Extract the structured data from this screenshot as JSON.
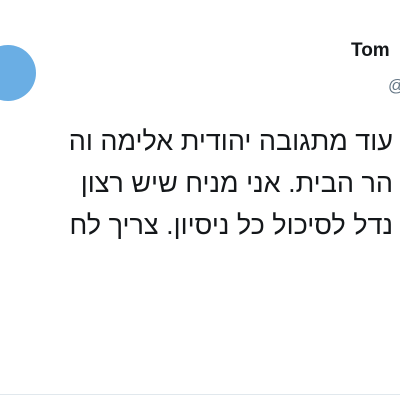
{
  "user": {
    "display_name": "Tom",
    "handle": "@"
  },
  "tweet": {
    "lines": [
      "עוד מתגובה יהודית אלימה וה",
      "הר הבית. אני מניח שיש רצון",
      "נדל לסיכול כל ניסיון. צריך לח"
    ]
  },
  "colors": {
    "avatar": "#6aaee4",
    "text": "#14171a",
    "secondary_text": "#657786"
  }
}
